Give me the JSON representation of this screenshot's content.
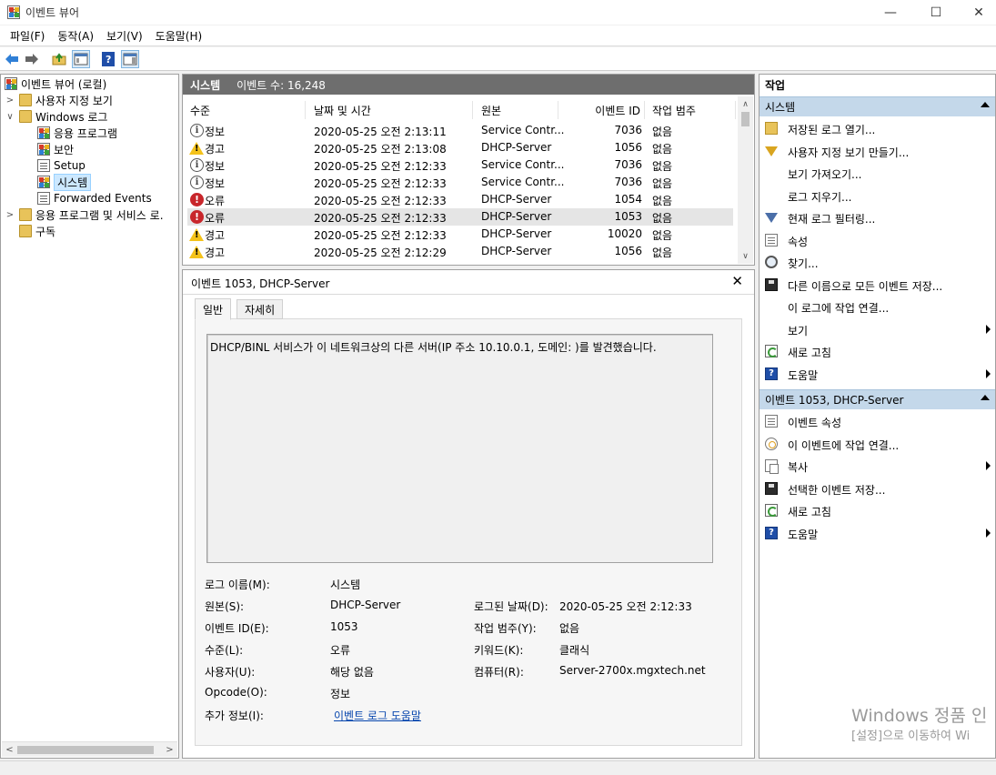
{
  "window": {
    "title": "이벤트 뷰어",
    "minimize": "—",
    "maximize": "☐",
    "close": "✕"
  },
  "menu": [
    "파일(F)",
    "동작(A)",
    "보기(V)",
    "도움말(H)"
  ],
  "tree": {
    "root": "이벤트 뷰어 (로컬)",
    "custom_views": "사용자 지정 보기",
    "windows_logs": "Windows 로그",
    "logs": [
      "응용 프로그램",
      "보안",
      "Setup",
      "시스템",
      "Forwarded Events"
    ],
    "app_services": "응용 프로그램 및 서비스 로.",
    "subscriptions": "구독"
  },
  "event_list": {
    "title": "시스템",
    "count": "이벤트 수: 16,248",
    "columns": [
      "수준",
      "날짜 및 시간",
      "원본",
      "이벤트 ID",
      "작업 범주"
    ],
    "rows": [
      {
        "level": "정보",
        "icon": "info-icon",
        "datetime": "2020-05-25 오전 2:13:11",
        "source": "Service Contr...",
        "id": "7036",
        "category": "없음"
      },
      {
        "level": "경고",
        "icon": "warning-icon",
        "datetime": "2020-05-25 오전 2:13:08",
        "source": "DHCP-Server",
        "id": "1056",
        "category": "없음"
      },
      {
        "level": "정보",
        "icon": "info-icon",
        "datetime": "2020-05-25 오전 2:12:33",
        "source": "Service Contr...",
        "id": "7036",
        "category": "없음"
      },
      {
        "level": "정보",
        "icon": "info-icon",
        "datetime": "2020-05-25 오전 2:12:33",
        "source": "Service Contr...",
        "id": "7036",
        "category": "없음"
      },
      {
        "level": "오류",
        "icon": "error-icon",
        "datetime": "2020-05-25 오전 2:12:33",
        "source": "DHCP-Server",
        "id": "1054",
        "category": "없음"
      },
      {
        "level": "오류",
        "icon": "error-icon",
        "datetime": "2020-05-25 오전 2:12:33",
        "source": "DHCP-Server",
        "id": "1053",
        "category": "없음",
        "selected": true
      },
      {
        "level": "경고",
        "icon": "warning-icon",
        "datetime": "2020-05-25 오전 2:12:33",
        "source": "DHCP-Server",
        "id": "10020",
        "category": "없음"
      },
      {
        "level": "경고",
        "icon": "warning-icon",
        "datetime": "2020-05-25 오전 2:12:29",
        "source": "DHCP-Server",
        "id": "1056",
        "category": "없음"
      }
    ]
  },
  "detail": {
    "title": "이벤트 1053, DHCP-Server",
    "tabs": [
      "일반",
      "자세히"
    ],
    "description": "DHCP/BINL 서비스가 이 네트워크상의 다른 서버(IP 주소 10.10.0.1, 도메인: )를 발견했습니다.",
    "props": {
      "log_name_label": "로그 이름(M):",
      "log_name": "시스템",
      "source_label": "원본(S):",
      "source": "DHCP-Server",
      "logged_label": "로그된 날짜(D):",
      "logged": "2020-05-25 오전 2:12:33",
      "event_id_label": "이벤트 ID(E):",
      "event_id": "1053",
      "task_label": "작업 범주(Y):",
      "task": "없음",
      "level_label": "수준(L):",
      "level": "오류",
      "keywords_label": "키워드(K):",
      "keywords": "클래식",
      "user_label": "사용자(U):",
      "user": "해당 없음",
      "computer_label": "컴퓨터(R):",
      "computer": "Server-2700x.mgxtech.net",
      "opcode_label": "Opcode(O):",
      "opcode": "정보",
      "more_label": "추가 정보(I):",
      "more_link": "이벤트 로그 도움말"
    }
  },
  "actions": {
    "title": "작업",
    "section1": "시스템",
    "items1": [
      {
        "label": "저장된 로그 열기...",
        "icon": "open-log-icon"
      },
      {
        "label": "사용자 지정 보기 만들기...",
        "icon": "create-view-icon"
      },
      {
        "label": "보기 가져오기...",
        "icon": ""
      },
      {
        "label": "로그 지우기...",
        "icon": ""
      },
      {
        "label": "현재 로그 필터링...",
        "icon": "filter-icon"
      },
      {
        "label": "속성",
        "icon": "properties-icon"
      },
      {
        "label": "찾기...",
        "icon": "find-icon"
      },
      {
        "label": "다른 이름으로 모든 이벤트 저장...",
        "icon": "save-icon"
      },
      {
        "label": "이 로그에 작업 연결...",
        "icon": ""
      },
      {
        "label": "보기",
        "icon": "",
        "submenu": true
      },
      {
        "label": "새로 고침",
        "icon": "refresh-icon"
      },
      {
        "label": "도움말",
        "icon": "help-icon",
        "submenu": true
      }
    ],
    "section2": "이벤트 1053, DHCP-Server",
    "items2": [
      {
        "label": "이벤트 속성",
        "icon": "event-properties-icon"
      },
      {
        "label": "이 이벤트에 작업 연결...",
        "icon": "attach-task-icon"
      },
      {
        "label": "복사",
        "icon": "copy-icon",
        "submenu": true
      },
      {
        "label": "선택한 이벤트 저장...",
        "icon": "save-icon"
      },
      {
        "label": "새로 고침",
        "icon": "refresh-icon"
      },
      {
        "label": "도움말",
        "icon": "help-icon",
        "submenu": true
      }
    ]
  },
  "watermark": {
    "line1": "Windows 정품 인",
    "line2": "[설정]으로 이동하여 Wi"
  }
}
